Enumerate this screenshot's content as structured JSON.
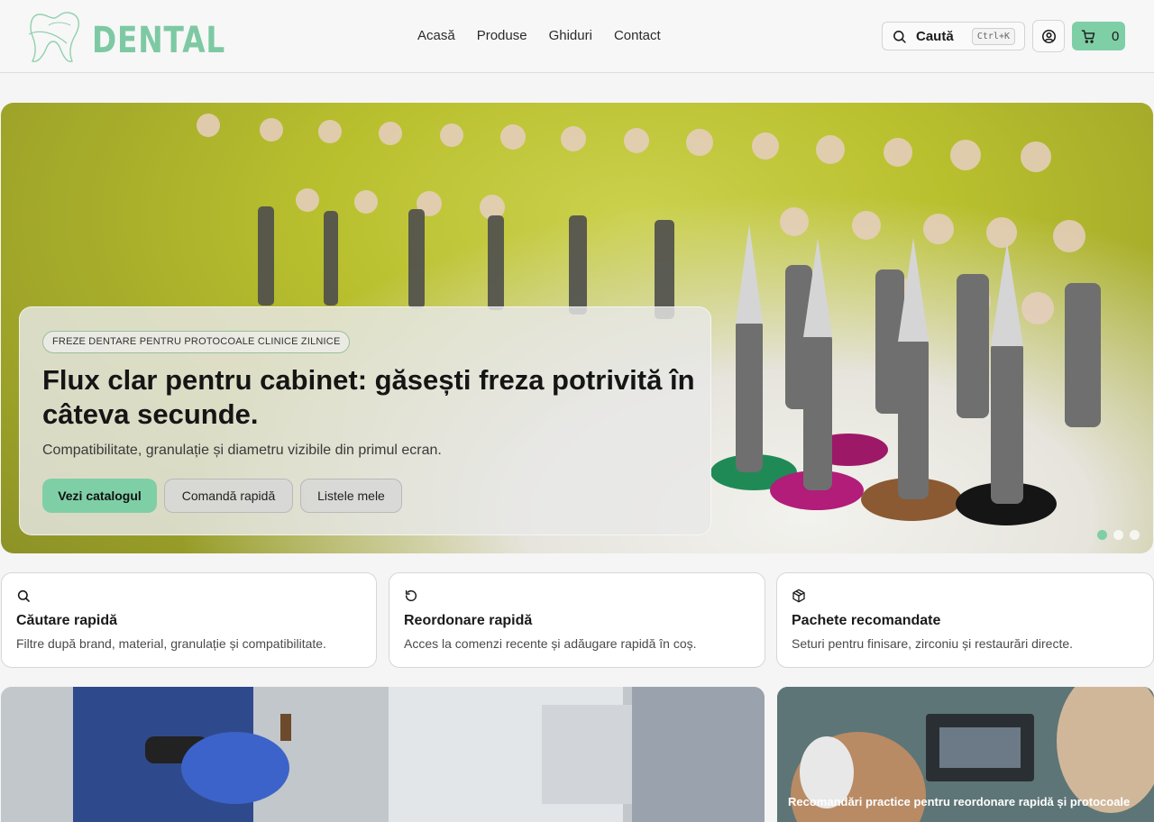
{
  "brand": {
    "name": "DENTAL",
    "accent": "#7fcfa6"
  },
  "nav": {
    "items": [
      "Acasă",
      "Produse",
      "Ghiduri",
      "Contact"
    ]
  },
  "header": {
    "search_label": "Caută",
    "search_shortcut": "Ctrl+K",
    "cart_count": "0",
    "icons": {
      "search": "search-icon",
      "user": "user-circle-icon",
      "cart": "cart-icon"
    }
  },
  "hero": {
    "eyebrow": "FREZE DENTARE PENTRU PROTOCOALE CLINICE ZILNICE",
    "title": "Flux clar pentru cabinet: găsești freza potrivită în câteva secunde.",
    "subtitle": "Compatibilitate, granulație și diametru vizibile din primul ecran.",
    "primary_button": "Vezi catalogul",
    "quick_order_button": "Comandă rapidă",
    "lists_button": "Listele mele",
    "carousel_slides": 3,
    "carousel_active": 1
  },
  "features": [
    {
      "icon": "search-icon",
      "title": "Căutare rapidă",
      "description": "Filtre după brand, material, granulație și compatibilitate."
    },
    {
      "icon": "reorder-icon",
      "title": "Reordonare rapidă",
      "description": "Acces la comenzi recente și adăugare rapidă în coș."
    },
    {
      "icon": "package-icon",
      "title": "Pachete recomandate",
      "description": "Seturi pentru finisare, zirconiu și restaurări directe."
    }
  ],
  "promo": {
    "right_caption": "Recomandări practice pentru reordonare rapidă și protocoale"
  }
}
